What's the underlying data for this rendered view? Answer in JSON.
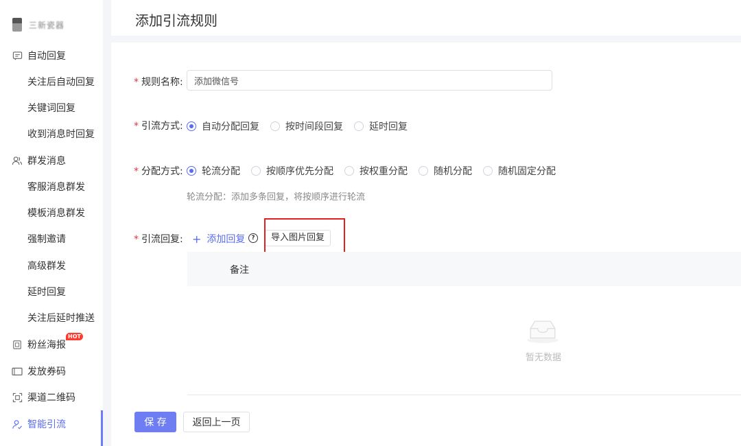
{
  "account": {
    "name": "三新瓷器"
  },
  "sidebar": {
    "items": [
      {
        "label": "自动回复",
        "icon": "message-icon",
        "type": "group"
      },
      {
        "label": "关注后自动回复",
        "type": "sub"
      },
      {
        "label": "关键词回复",
        "type": "sub"
      },
      {
        "label": "收到消息时回复",
        "type": "sub"
      },
      {
        "label": "群发消息",
        "icon": "users-icon",
        "type": "group"
      },
      {
        "label": "客服消息群发",
        "type": "sub"
      },
      {
        "label": "模板消息群发",
        "type": "sub"
      },
      {
        "label": "强制邀请",
        "type": "sub"
      },
      {
        "label": "高级群发",
        "type": "sub"
      },
      {
        "label": "延时回复",
        "type": "sub"
      },
      {
        "label": "关注后延时推送",
        "type": "sub"
      },
      {
        "label": "粉丝海报",
        "icon": "poster-icon",
        "type": "group",
        "badge": "HOT"
      },
      {
        "label": "发放券码",
        "icon": "coupon-icon",
        "type": "group"
      },
      {
        "label": "渠道二维码",
        "icon": "qrcode-icon",
        "type": "group"
      },
      {
        "label": "智能引流",
        "icon": "user-flow-icon",
        "type": "group",
        "active": true
      }
    ]
  },
  "header": {
    "title": "添加引流规则"
  },
  "form": {
    "required_mark": "*",
    "rule_name": {
      "label": "规则名称:",
      "value": "添加微信号"
    },
    "method": {
      "label": "引流方式:",
      "options": [
        "自动分配回复",
        "按时间段回复",
        "延时回复"
      ],
      "selected": "自动分配回复"
    },
    "distribution": {
      "label": "分配方式:",
      "options": [
        "轮流分配",
        "按顺序优先分配",
        "按权重分配",
        "随机分配",
        "随机固定分配"
      ],
      "selected": "轮流分配",
      "hint": "轮流分配：添加多条回复，将按顺序进行轮流"
    },
    "reply": {
      "label": "引流回复:",
      "add_label": "添加回复",
      "import_label": "导入图片回复",
      "help_glyph": "?",
      "table": {
        "columns": [
          "备注"
        ],
        "empty_text": "暂无数据"
      }
    }
  },
  "actions": {
    "save_label": "保 存",
    "back_label": "返回上一页"
  },
  "colors": {
    "accent": "#5a6cf0",
    "save_button": "#6e7ef2",
    "required": "#e4393c",
    "highlight": "#e02020"
  }
}
